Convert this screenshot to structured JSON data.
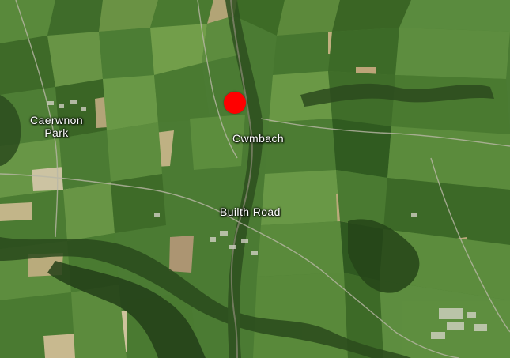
{
  "map": {
    "labels": {
      "caerwnon_line1": "Caerwnon",
      "caerwnon_line2": "Park",
      "cwmbach": "Cwmbach",
      "builth_road": "Builth Road"
    },
    "marker_color": "#ff0000",
    "imagery": "satellite"
  }
}
